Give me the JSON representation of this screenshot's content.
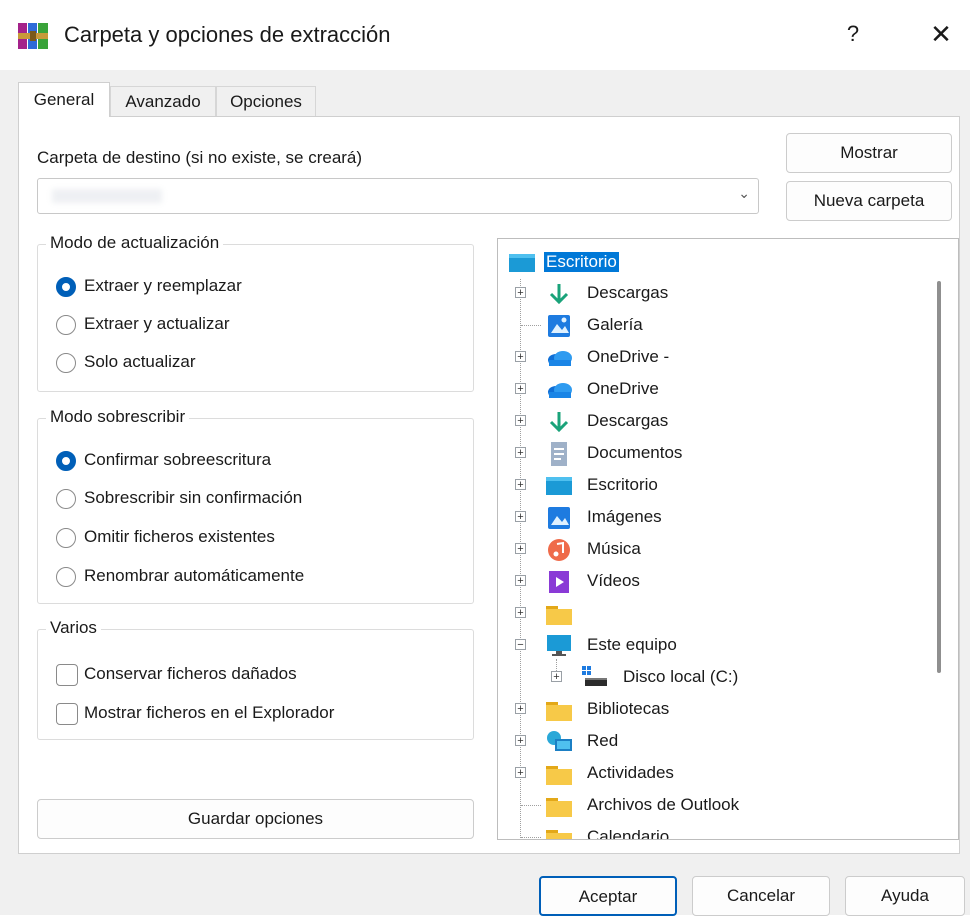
{
  "window": {
    "title": "Carpeta y opciones de extracción",
    "help_label": "?",
    "close_label": "✕"
  },
  "tabs": [
    {
      "label": "General",
      "active": true
    },
    {
      "label": "Avanzado",
      "active": false
    },
    {
      "label": "Opciones",
      "active": false
    }
  ],
  "destination": {
    "label": "Carpeta de destino (si no existe, se creará)",
    "value": "",
    "show_button": "Mostrar",
    "new_folder_button": "Nueva carpeta"
  },
  "update_mode": {
    "title": "Modo de actualización",
    "options": [
      {
        "label": "Extraer y reemplazar",
        "selected": true
      },
      {
        "label": "Extraer y actualizar",
        "selected": false
      },
      {
        "label": "Solo actualizar",
        "selected": false
      }
    ]
  },
  "overwrite_mode": {
    "title": "Modo sobrescribir",
    "options": [
      {
        "label": "Confirmar sobreescritura",
        "selected": true
      },
      {
        "label": "Sobrescribir sin confirmación",
        "selected": false
      },
      {
        "label": "Omitir ficheros existentes",
        "selected": false
      },
      {
        "label": "Renombrar automáticamente",
        "selected": false
      }
    ]
  },
  "misc": {
    "title": "Varios",
    "options": [
      {
        "label": "Conservar ficheros dañados",
        "checked": false
      },
      {
        "label": "Mostrar ficheros en el Explorador",
        "checked": false
      }
    ]
  },
  "save_button": "Guardar opciones",
  "tree": {
    "nodes": [
      {
        "label": "Escritorio",
        "icon": "desktop-icon",
        "selected": true
      },
      {
        "label": "Descargas",
        "icon": "download-icon"
      },
      {
        "label": "Galería",
        "icon": "gallery-icon"
      },
      {
        "label": "OneDrive -",
        "icon": "onedrive-icon"
      },
      {
        "label": "OneDrive",
        "icon": "onedrive-icon"
      },
      {
        "label": "Descargas",
        "icon": "download-icon"
      },
      {
        "label": "Documentos",
        "icon": "documents-icon"
      },
      {
        "label": "Escritorio",
        "icon": "desktop-icon"
      },
      {
        "label": "Imágenes",
        "icon": "pictures-icon"
      },
      {
        "label": "Música",
        "icon": "music-icon"
      },
      {
        "label": "Vídeos",
        "icon": "videos-icon"
      },
      {
        "label": "",
        "icon": "folder-icon"
      },
      {
        "label": "Este equipo",
        "icon": "computer-icon"
      },
      {
        "label": "Disco local (C:)",
        "icon": "drive-icon"
      },
      {
        "label": "Bibliotecas",
        "icon": "folder-icon"
      },
      {
        "label": "Red",
        "icon": "network-icon"
      },
      {
        "label": "Actividades",
        "icon": "folder-icon"
      },
      {
        "label": "Archivos de Outlook",
        "icon": "folder-icon"
      },
      {
        "label": "Calendario",
        "icon": "folder-icon"
      }
    ]
  },
  "footer": {
    "ok": "Aceptar",
    "cancel": "Cancelar",
    "help": "Ayuda"
  },
  "colors": {
    "accent": "#005fb8",
    "selection": "#0078d7",
    "folder": "#f7c948"
  }
}
